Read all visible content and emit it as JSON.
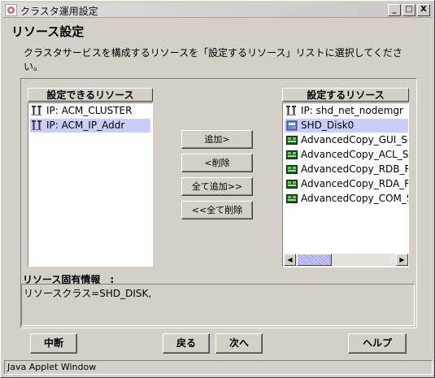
{
  "window": {
    "title": "クラスタ運用設定"
  },
  "title_buttons": {
    "minimize": "_",
    "maximize": "□",
    "close": "X"
  },
  "page": {
    "heading": "リソース設定",
    "description": "クラスタサービスを構成するリソースを「設定するリソース」リストに選択してください。"
  },
  "available": {
    "header": "設定できるリソース",
    "items": [
      {
        "label": "IP: ACM_CLUSTER",
        "icon": "ip-resource-icon",
        "selected": false
      },
      {
        "label": "IP: ACM_IP_Addr",
        "icon": "ip-resource-icon",
        "selected": true
      }
    ]
  },
  "selected": {
    "header": "設定するリソース",
    "items": [
      {
        "label": "IP: shd_net_nodemgr",
        "icon": "ip-resource-icon",
        "selected": false
      },
      {
        "label": "SHD_Disk0",
        "icon": "disk-resource-icon",
        "selected": true
      },
      {
        "label": "AdvancedCopy_GUI_Ser",
        "icon": "advanced-copy-icon",
        "selected": false
      },
      {
        "label": "AdvancedCopy_ACL_Se",
        "icon": "advanced-copy-icon",
        "selected": false
      },
      {
        "label": "AdvancedCopy_RDB_Rl",
        "icon": "advanced-copy-icon",
        "selected": false
      },
      {
        "label": "AdvancedCopy_RDA_Rl",
        "icon": "advanced-copy-icon",
        "selected": false
      },
      {
        "label": "AdvancedCopy_COM_Se",
        "icon": "advanced-copy-icon",
        "selected": false
      }
    ]
  },
  "transfer_buttons": {
    "add": "追加>",
    "remove": "<削除",
    "add_all": "全て追加>>",
    "remove_all": "<<全て削除"
  },
  "info": {
    "label": "リソース固有情報　:",
    "text": "リソースクラス=SHD_DISK,"
  },
  "bottom_buttons": {
    "abort": "中断",
    "back": "戻る",
    "next": "次へ",
    "help": "ヘルプ"
  },
  "status": {
    "text": "Java Applet Window"
  },
  "colors": {
    "selection": "#ccccff",
    "face": "#d4d0c8",
    "list_bg": "#ffffff"
  }
}
